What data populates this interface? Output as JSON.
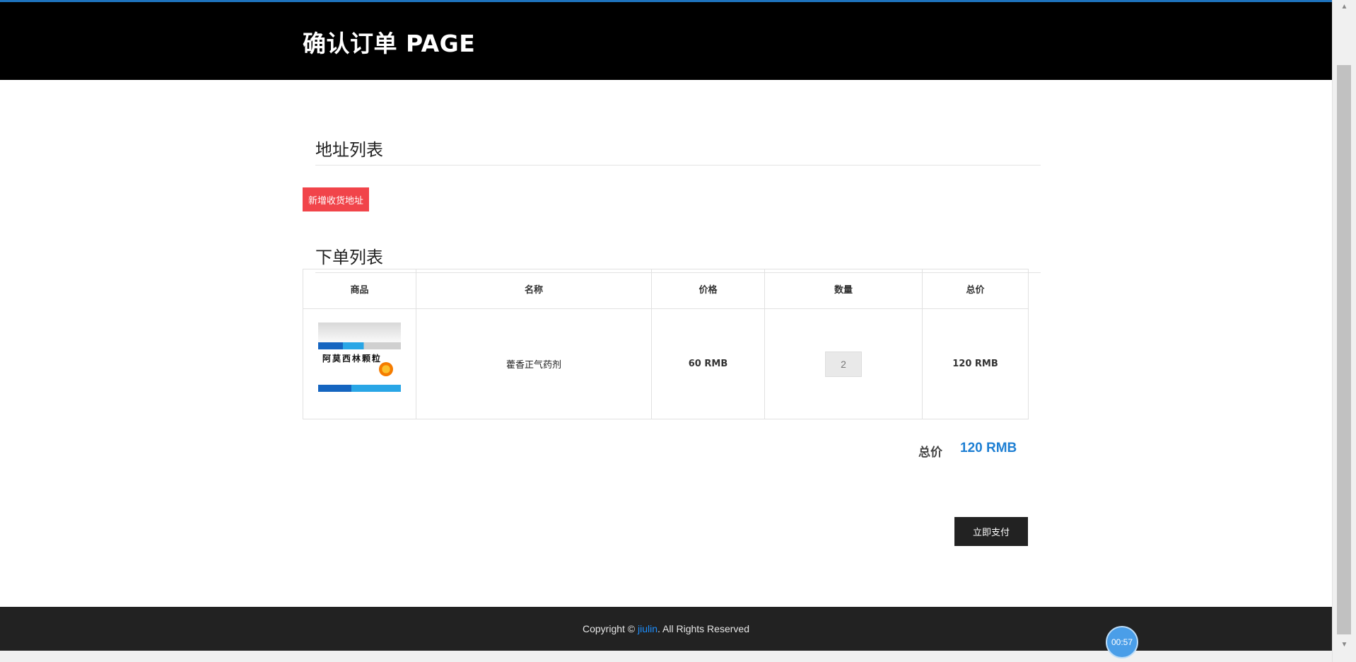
{
  "header": {
    "title": "确认订单 PAGE"
  },
  "address_section": {
    "heading": "地址列表",
    "add_button_label": "新增收货地址"
  },
  "order_section": {
    "heading": "下单列表",
    "columns": [
      "商品",
      "名称",
      "价格",
      "数量",
      "总价"
    ],
    "rows": [
      {
        "image_label": "阿莫西林颗粒",
        "name": "藿香正气药剂",
        "price": "60 RMB",
        "quantity": "2",
        "subtotal": "120 RMB"
      }
    ]
  },
  "summary": {
    "total_label": "总价",
    "total_value": "120 RMB",
    "pay_button_label": "立即支付"
  },
  "footer": {
    "prefix": "Copyright © ",
    "link": "jiulin",
    "suffix": ". All Rights Reserved"
  },
  "timer": {
    "value": "00:57"
  },
  "colors": {
    "header_bg": "#000000",
    "accent_blue": "#1e7fd3",
    "add_button_red": "#f1444a",
    "pay_button_bg": "#222222",
    "footer_bg": "#222222"
  }
}
